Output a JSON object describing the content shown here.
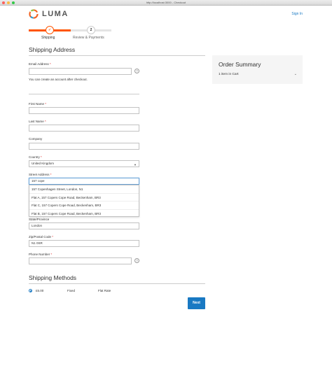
{
  "window": {
    "title": "http://localhost:3000 - Checkout",
    "dot_colors": [
      "#fc605c",
      "#fdbc40",
      "#34c84a"
    ]
  },
  "header": {
    "logo_text": "LUMA",
    "signin_label": "Sign In"
  },
  "progress": {
    "steps": [
      {
        "number": "",
        "label": "Shipping",
        "state": "active"
      },
      {
        "number": "2",
        "label": "Review & Payments",
        "state": "pending"
      }
    ],
    "accent": "#ff5501"
  },
  "shipping_address": {
    "title": "Shipping Address",
    "email": {
      "label": "Email Address",
      "required": "*",
      "value": "",
      "note": "You can create an account after checkout."
    },
    "first_name": {
      "label": "First Name",
      "required": "*",
      "value": ""
    },
    "last_name": {
      "label": "Last Name",
      "required": "*",
      "value": ""
    },
    "company": {
      "label": "Company",
      "value": ""
    },
    "country": {
      "label": "Country",
      "required": "*",
      "value": "United Kingdom"
    },
    "street": {
      "label": "Street Address",
      "required": "*",
      "value": "157 cope"
    },
    "suggestions": [
      "157 Copenhagen Street, London, N1",
      "Flat A, 157 Copers Cope Road, Beckenham, BR3",
      "Flat C, 157 Copers Cope Road, Beckenham, BR3",
      "Flat B, 157 Copers Cope Road, Beckenham, BR3"
    ],
    "state": {
      "label": "State/Province",
      "value": "London"
    },
    "zip": {
      "label": "Zip/Postal Code",
      "required": "*",
      "value": "N1 0SR"
    },
    "phone": {
      "label": "Phone Number",
      "required": "*",
      "value": ""
    },
    "help_glyph": "?"
  },
  "order_summary": {
    "title": "Order Summary",
    "items_label": "1 item in Cart"
  },
  "shipping_methods": {
    "title": "Shipping Methods",
    "method": {
      "price": "£5.00",
      "name": "Fixed",
      "carrier": "Flat Rate"
    }
  },
  "next_button": "Next",
  "accent": "#1979c3"
}
